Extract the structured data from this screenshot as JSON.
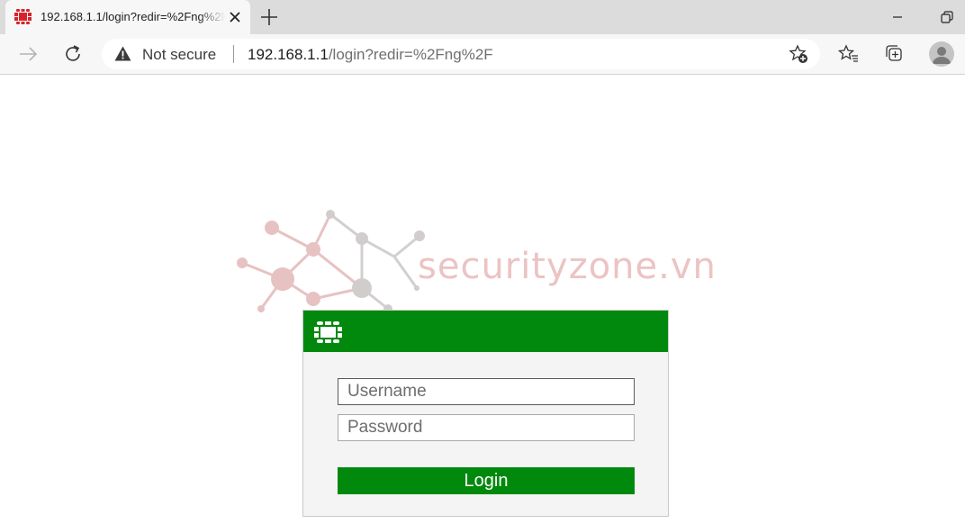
{
  "browser": {
    "tab": {
      "title": "192.168.1.1/login?redir=%2Fng%2F"
    },
    "address_bar": {
      "security_label": "Not secure",
      "host": "192.168.1.1",
      "path": "/login?redir=%2Fng%2F"
    },
    "icons": {
      "tab_favicon": "fortinet-favicon",
      "tab_close": "close-icon",
      "new_tab": "plus-icon",
      "minimize": "minimize-icon",
      "restore": "restore-icon",
      "back": "back-arrow-icon",
      "reload": "reload-icon",
      "warning": "warning-icon",
      "add_favorite": "star-add-icon",
      "favorites": "favorites-icon",
      "collections": "collections-icon",
      "profile": "avatar"
    }
  },
  "watermark": {
    "text": "securityzone.vn"
  },
  "login": {
    "username_placeholder": "Username",
    "password_placeholder": "Password",
    "button_label": "Login"
  },
  "colors": {
    "header_green": "#01890d",
    "button_green": "#01890d",
    "favicon_red": "#d9232a",
    "watermark_pink": "#ecc3c3"
  }
}
